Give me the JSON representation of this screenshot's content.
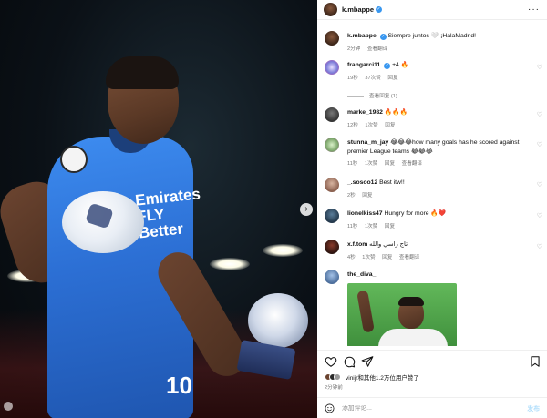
{
  "post": {
    "username": "k.mbappe",
    "verified_icon": "verified-badge-icon",
    "more_icon": "more-options-icon",
    "caption_text": "Siempre juntos 🤍 ¡HalaMadrid!",
    "caption_time": "2分钟",
    "caption_translate": "查看翻译",
    "jersey_text": "Emirates FLY Better",
    "jersey_number": "10"
  },
  "comments": [
    {
      "user": "frangarci11",
      "verified": true,
      "text": "+4 🔥",
      "time": "19秒",
      "likes": "37次赞",
      "reply": "回复",
      "translate": "",
      "view_replies": "查看回复 (1)"
    },
    {
      "user": "marke_1982",
      "verified": false,
      "text": "🔥🔥🔥",
      "time": "12秒",
      "likes": "1次赞",
      "reply": "回复",
      "translate": ""
    },
    {
      "user": "stunna_m_jay",
      "verified": false,
      "text": "😂😂😂how many goals has he scored against premier League teams 😂😂😂",
      "time": "11秒",
      "likes": "1次赞",
      "reply": "回复",
      "translate": "查看翻译"
    },
    {
      "user": "_.sosoo12",
      "verified": false,
      "text": "Best itw!!",
      "time": "2秒",
      "likes": "",
      "reply": "回复",
      "translate": ""
    },
    {
      "user": "lionelkiss47",
      "verified": false,
      "text": "Hungry for more 🔥❤️",
      "time": "11秒",
      "likes": "1次赞",
      "reply": "回复",
      "translate": ""
    },
    {
      "user": "x.f.tom",
      "verified": false,
      "text": "تاج راسي والله",
      "time": "4秒",
      "likes": "1次赞",
      "reply": "回复",
      "translate": "查看翻译"
    },
    {
      "user": "the_diva_",
      "verified": false,
      "text": "",
      "time": "",
      "likes": "",
      "reply": "",
      "translate": ""
    }
  ],
  "actions": {
    "like_icon": "heart-outline-icon",
    "comment_icon": "comment-bubble-icon",
    "share_icon": "paper-plane-icon",
    "save_icon": "bookmark-icon"
  },
  "likes": {
    "text": "vinijr和其他1.2万位用户赞了",
    "time": "2分钟前"
  },
  "add_comment": {
    "placeholder": "添加评论...",
    "post_label": "发布",
    "emoji_icon": "emoji-smiley-icon"
  },
  "colors": {
    "verified": "#3897f0",
    "meta_text": "#737373",
    "post_button": "#b2dffc",
    "jersey_blue": "#2c6fd4"
  }
}
